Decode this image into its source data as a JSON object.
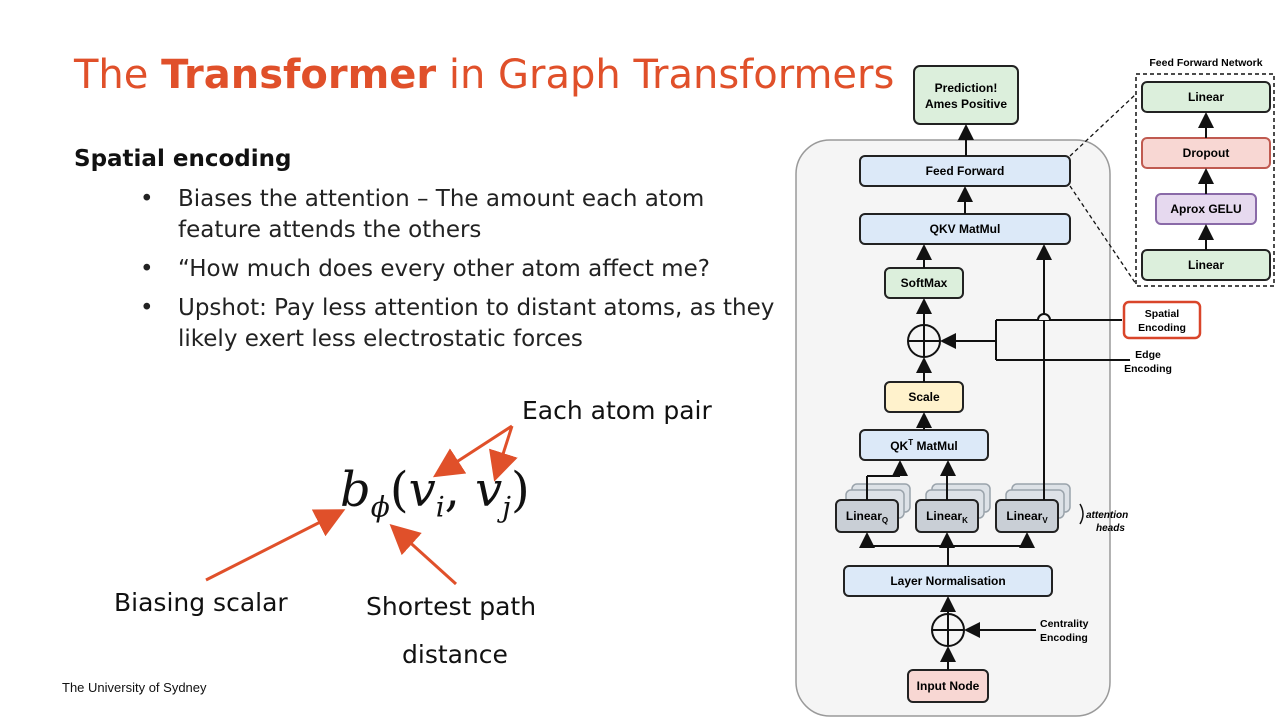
{
  "slide": {
    "title_pre": "The ",
    "title_bold": "Transformer",
    "title_post": " in Graph Transformers",
    "subheading": "Spatial encoding",
    "bullets": [
      "Biases the attention – The amount each atom feature attends the others",
      "“How much does every other atom affect me?",
      "Upshot: Pay less attention to distant atoms, as they likely exert less electrostatic forces"
    ],
    "callouts": {
      "atom_pair": "Each atom pair",
      "biasing": "Biasing scalar",
      "shortest_line1": "Shortest path",
      "shortest_line2": "distance"
    },
    "formula": {
      "b": "b",
      "phi": "ϕ",
      "open": "(",
      "v1": "v",
      "i": "i",
      "comma": ", ",
      "v2": "v",
      "j": "j",
      "close": ")"
    },
    "footer": "The University of Sydney"
  },
  "diagram": {
    "prediction_line1": "Prediction!",
    "prediction_line2": "Ames Positive",
    "feed_forward": "Feed Forward",
    "qkv_matmul": "QKV MatMul",
    "softmax": "SoftMax",
    "scale": "Scale",
    "qkt_matmul_pre": "QK",
    "qkt_sup": "T",
    "qkt_matmul_post": " MatMul",
    "linear_label": "Linear",
    "sub_q": "Q",
    "sub_k": "K",
    "sub_v": "V",
    "attention_heads_line1": "attention",
    "attention_heads_line2": "heads",
    "layer_norm": "Layer Normalisation",
    "input_node": "Input Node",
    "centrality_line1": "Centrality",
    "centrality_line2": "Encoding",
    "spatial_line1": "Spatial",
    "spatial_line2": "Encoding",
    "edge_line1": "Edge",
    "edge_line2": "Encoding",
    "ffn_title": "Feed Forward Network",
    "ffn_linear_top": "Linear",
    "ffn_dropout": "Dropout",
    "ffn_gelu": "Aprox GELU",
    "ffn_linear_bottom": "Linear"
  },
  "colors": {
    "title": "#e0502a",
    "arrow": "#e0502a",
    "blue_block": "#dce9f8",
    "green_block": "#dcefdc",
    "yellow_block": "#fff2cc",
    "red_block": "#f8d7d3",
    "purple_block": "#e6d9ef",
    "gray_block": "#c9cfd6",
    "spatial_highlight": "#d9452a"
  }
}
